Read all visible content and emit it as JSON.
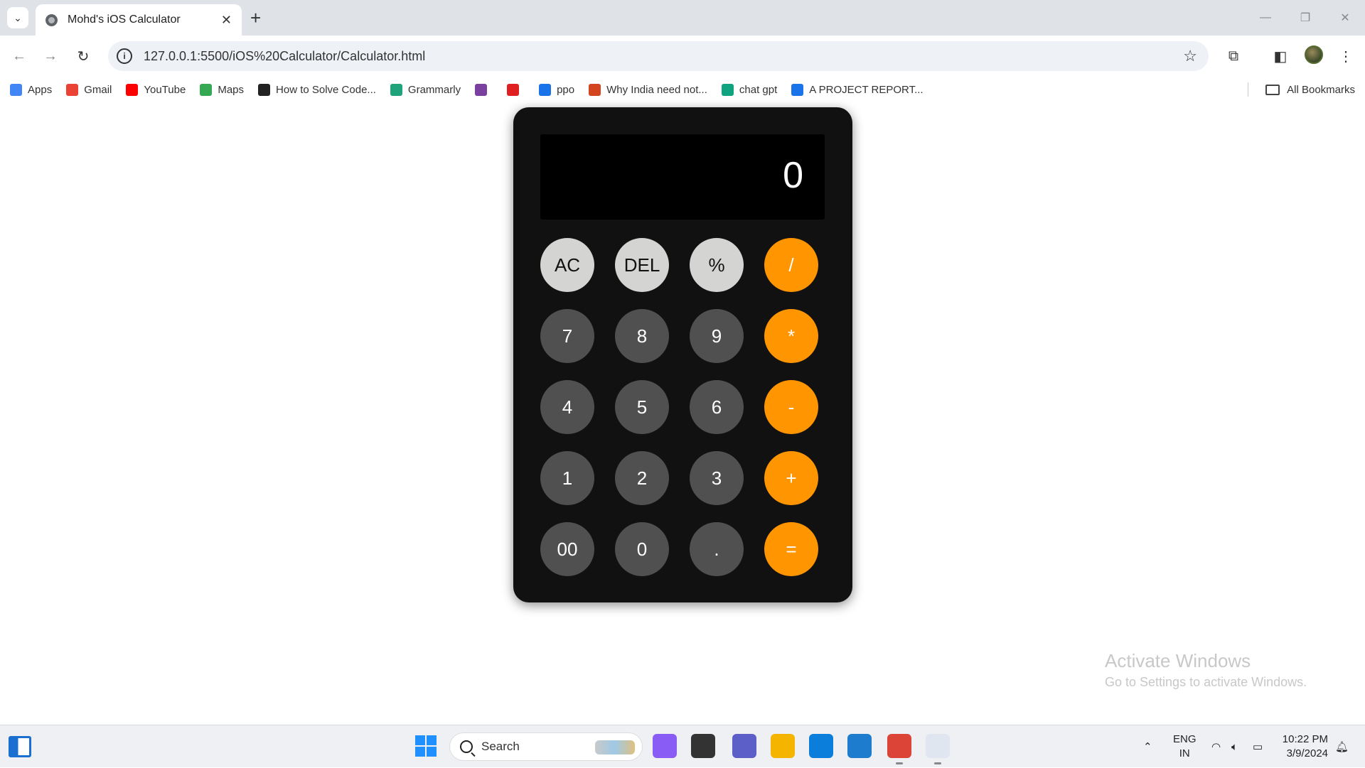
{
  "browser": {
    "tab_title": "Mohd's iOS Calculator",
    "url": "127.0.0.1:5500/iOS%20Calculator/Calculator.html",
    "bookmarks": [
      {
        "label": "Apps",
        "icon": "apps-grid-icon",
        "color": "#4285f4"
      },
      {
        "label": "Gmail",
        "icon": "gmail-icon",
        "color": "#ea4335"
      },
      {
        "label": "YouTube",
        "icon": "youtube-icon",
        "color": "#ff0000"
      },
      {
        "label": "Maps",
        "icon": "maps-pin-icon",
        "color": "#34a853"
      },
      {
        "label": "How to Solve Code...",
        "icon": "code-site-icon",
        "color": "#222222"
      },
      {
        "label": "Grammarly",
        "icon": "grammarly-icon",
        "color": "#1fa37a"
      },
      {
        "label": "",
        "icon": "purple-app-icon",
        "color": "#7b3fa0"
      },
      {
        "label": "",
        "icon": "red-pin-icon",
        "color": "#e02020"
      },
      {
        "label": "ppo",
        "icon": "chart-bars-icon",
        "color": "#1a73e8"
      },
      {
        "label": "Why India need not...",
        "icon": "circle-news-icon",
        "color": "#d2451e"
      },
      {
        "label": "chat gpt",
        "icon": "openai-icon",
        "color": "#10a37f"
      },
      {
        "label": "A PROJECT REPORT...",
        "icon": "doc-icon",
        "color": "#1a73e8"
      }
    ],
    "all_bookmarks": "All Bookmarks"
  },
  "calculator": {
    "display": "0",
    "keys": [
      {
        "label": "AC",
        "type": "fn",
        "name": "clear-button"
      },
      {
        "label": "DEL",
        "type": "fn",
        "name": "delete-button"
      },
      {
        "label": "%",
        "type": "fn",
        "name": "percent-button"
      },
      {
        "label": "/",
        "type": "op",
        "name": "divide-button"
      },
      {
        "label": "7",
        "type": "num",
        "name": "digit-7-button"
      },
      {
        "label": "8",
        "type": "num",
        "name": "digit-8-button"
      },
      {
        "label": "9",
        "type": "num",
        "name": "digit-9-button"
      },
      {
        "label": "*",
        "type": "op",
        "name": "multiply-button"
      },
      {
        "label": "4",
        "type": "num",
        "name": "digit-4-button"
      },
      {
        "label": "5",
        "type": "num",
        "name": "digit-5-button"
      },
      {
        "label": "6",
        "type": "num",
        "name": "digit-6-button"
      },
      {
        "label": "-",
        "type": "op",
        "name": "subtract-button"
      },
      {
        "label": "1",
        "type": "num",
        "name": "digit-1-button"
      },
      {
        "label": "2",
        "type": "num",
        "name": "digit-2-button"
      },
      {
        "label": "3",
        "type": "num",
        "name": "digit-3-button"
      },
      {
        "label": "+",
        "type": "op",
        "name": "add-button"
      },
      {
        "label": "00",
        "type": "num",
        "name": "double-zero-button"
      },
      {
        "label": "0",
        "type": "num",
        "name": "digit-0-button"
      },
      {
        "label": ".",
        "type": "num",
        "name": "decimal-button"
      },
      {
        "label": "=",
        "type": "op",
        "name": "equals-button"
      }
    ],
    "colors": {
      "function": "#d4d4d2",
      "number": "#505050",
      "operator": "#ff9500",
      "body": "#111111"
    }
  },
  "watermark": {
    "title": "Activate Windows",
    "subtitle": "Go to Settings to activate Windows."
  },
  "taskbar": {
    "search_label": "Search",
    "apps": [
      {
        "name": "copilot-icon",
        "color": "#8a5cf6"
      },
      {
        "name": "task-view-icon",
        "color": "#333333"
      },
      {
        "name": "teams-icon",
        "color": "#5b5fc7"
      },
      {
        "name": "file-explorer-icon",
        "color": "#f4b400"
      },
      {
        "name": "edge-icon",
        "color": "#0b7dda"
      },
      {
        "name": "vscode-icon",
        "color": "#1e7ccf"
      },
      {
        "name": "chrome-icon",
        "color": "#db4437"
      },
      {
        "name": "snipping-tool-icon",
        "color": "#e0e6f0"
      }
    ],
    "language_top": "ENG",
    "language_bottom": "IN",
    "time": "10:22 PM",
    "date": "3/9/2024"
  }
}
